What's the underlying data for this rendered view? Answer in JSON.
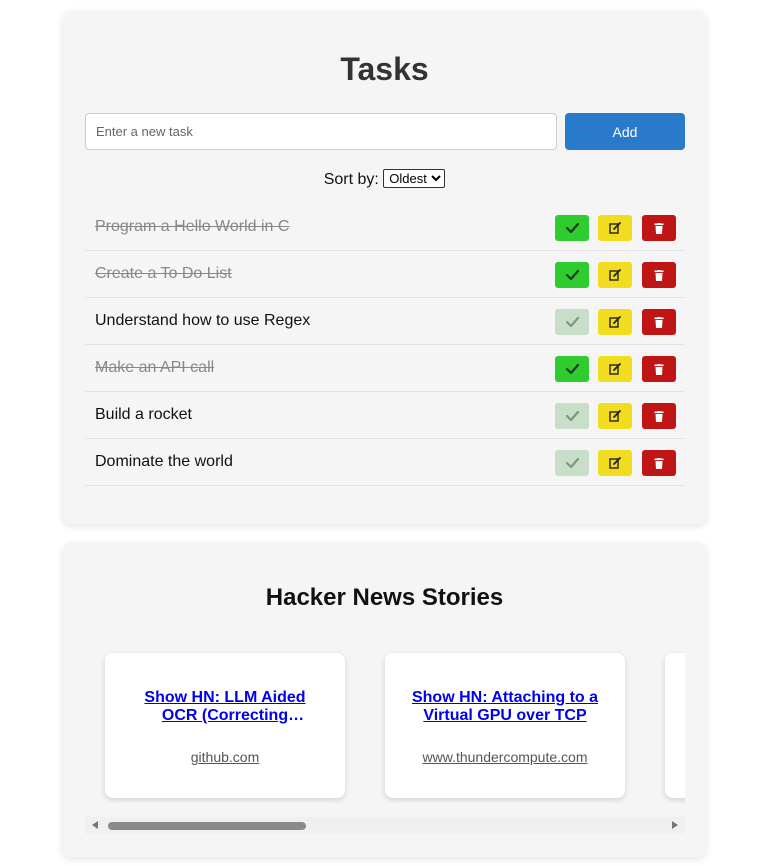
{
  "tasks_section": {
    "title": "Tasks",
    "input": {
      "placeholder": "Enter a new task",
      "value": ""
    },
    "add_label": "Add",
    "sort": {
      "label": "Sort by:",
      "selected": "Oldest"
    },
    "items": [
      {
        "text": "Program a Hello World in C",
        "done": true
      },
      {
        "text": "Create a To Do List",
        "done": true
      },
      {
        "text": "Understand how to use Regex",
        "done": false
      },
      {
        "text": "Make an API call",
        "done": true
      },
      {
        "text": "Build a rocket",
        "done": false
      },
      {
        "text": "Dominate the world",
        "done": false
      }
    ],
    "icons": {
      "complete": "check-icon",
      "edit": "edit-icon",
      "delete": "trash-icon"
    }
  },
  "hacker_news": {
    "title": "Hacker News Stories",
    "stories": [
      {
        "title": "Show HN: LLM Aided OCR (Correcting Tesseract OCR Errors with LLMs)",
        "domain": "github.com"
      },
      {
        "title": "Show HN: Attaching to a Virtual GPU over TCP",
        "domain": "www.thundercompute.com"
      }
    ]
  },
  "colors": {
    "accent": "#2a7acc",
    "complete": "#2ecc2e",
    "complete_inactive": "#c9dec9",
    "edit": "#f2dc1f",
    "delete": "#c01515",
    "link": "#0000ee"
  }
}
